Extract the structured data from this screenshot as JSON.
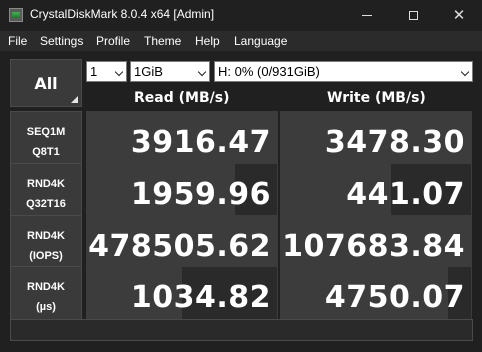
{
  "window": {
    "title": "CrystalDiskMark 8.0.4 x64 [Admin]",
    "minimize_icon": "minimize-icon",
    "maximize_icon": "maximize-icon",
    "close_glyph": "✕"
  },
  "menu": [
    "File",
    "Settings",
    "Profile",
    "Theme",
    "Help",
    "Language"
  ],
  "controls": {
    "all_label": "All",
    "count": "1",
    "size": "1GiB",
    "drive": "H: 0% (0/931GiB)"
  },
  "headers": {
    "read": "Read (MB/s)",
    "write": "Write (MB/s)"
  },
  "rows": [
    {
      "line1": "SEQ1M",
      "line2": "Q8T1",
      "read": "3916.47",
      "write": "3478.30",
      "read_fill": 1.0,
      "write_fill": 1.0
    },
    {
      "line1": "RND4K",
      "line2": "Q32T16",
      "read": "1959.96",
      "write": "441.07",
      "read_fill": 0.78,
      "write_fill": 0.58
    },
    {
      "line1": "RND4K",
      "line2": "(IOPS)",
      "read": "478505.62",
      "write": "107683.84",
      "read_fill": 1.0,
      "write_fill": 1.0
    },
    {
      "line1": "RND4K",
      "line2": "(µs)",
      "read": "1034.82",
      "write": "4750.07",
      "read_fill": 0.5,
      "write_fill": 0.88
    }
  ],
  "status_text": "",
  "colors": {
    "background": "#202020",
    "cell": "#2a2a2a",
    "bar": "#3c3c3c",
    "label_bg": "#3a3a3a"
  }
}
